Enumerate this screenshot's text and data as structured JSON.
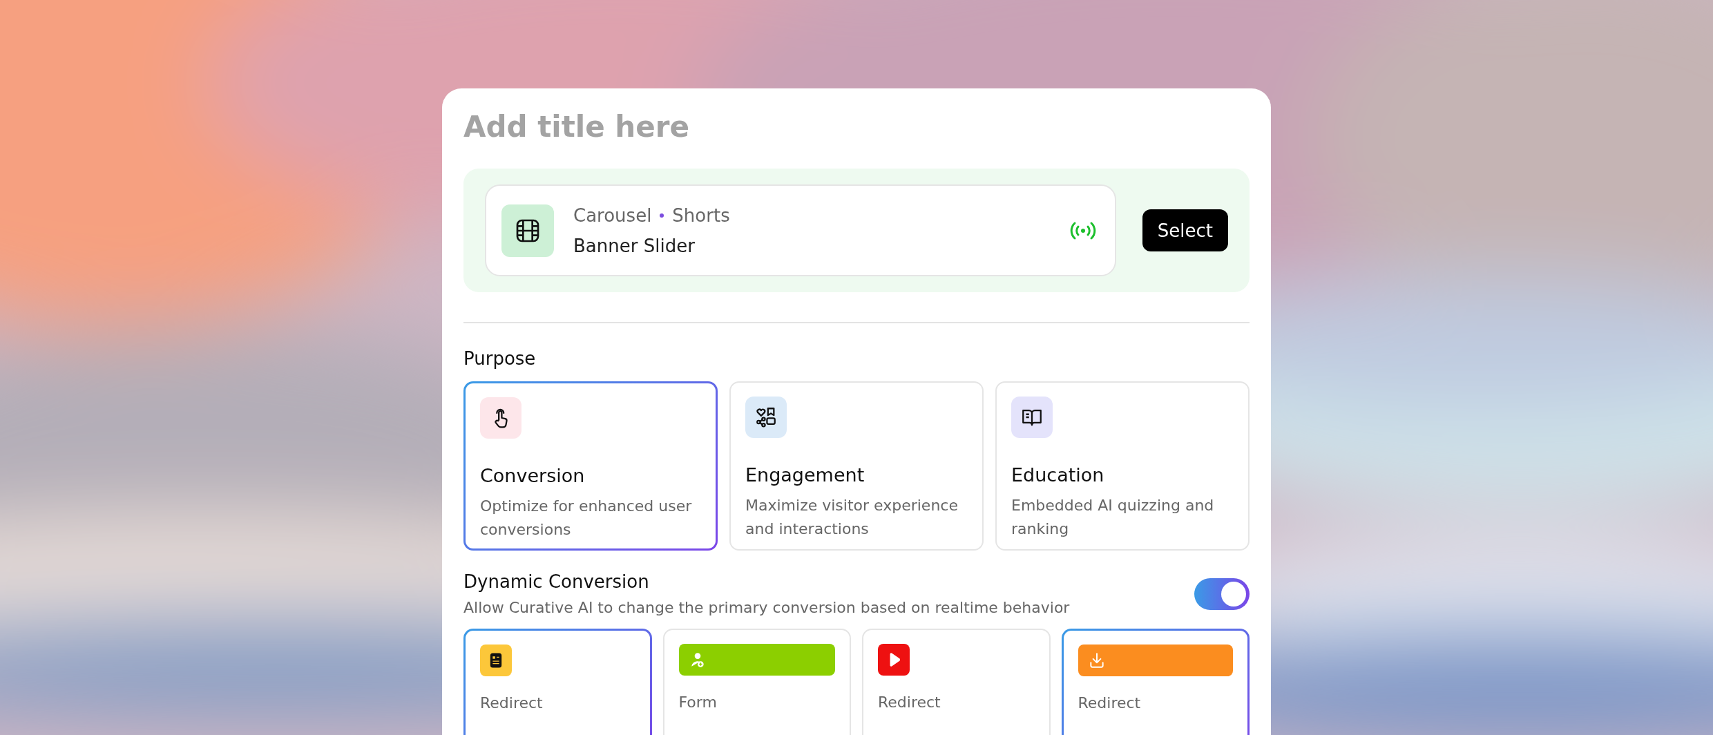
{
  "title_field": {
    "placeholder": "Add title here"
  },
  "widget": {
    "types": [
      "Carousel",
      "Shorts"
    ],
    "name": "Banner Slider",
    "live": true,
    "button": "Select"
  },
  "purpose": {
    "heading": "Purpose",
    "options": [
      {
        "title": "Conversion",
        "description": "Optimize for enhanced user conversions",
        "selected": true,
        "color": "#fde6ea"
      },
      {
        "title": "Engagement",
        "description": "Maximize visitor experience and interactions",
        "selected": false,
        "color": "#dbeaf8"
      },
      {
        "title": "Education",
        "description": "Embedded AI quizzing and ranking",
        "selected": false,
        "color": "#e4e3fb"
      }
    ]
  },
  "dynamic_conversion": {
    "title": "Dynamic Conversion",
    "description": "Allow Curative AI to change the primary conversion based on realtime behavior",
    "on": true
  },
  "conversions": [
    {
      "kind": "tile",
      "color": "#fcc73a",
      "type": "Redirect",
      "selected": true
    },
    {
      "kind": "bar",
      "color": "#8ccf00",
      "type": "Form",
      "selected": false
    },
    {
      "kind": "tile",
      "color": "#ee1111",
      "type": "Redirect",
      "selected": false
    },
    {
      "kind": "bar",
      "color": "#fb8d1f",
      "type": "Redirect",
      "selected": true
    }
  ]
}
